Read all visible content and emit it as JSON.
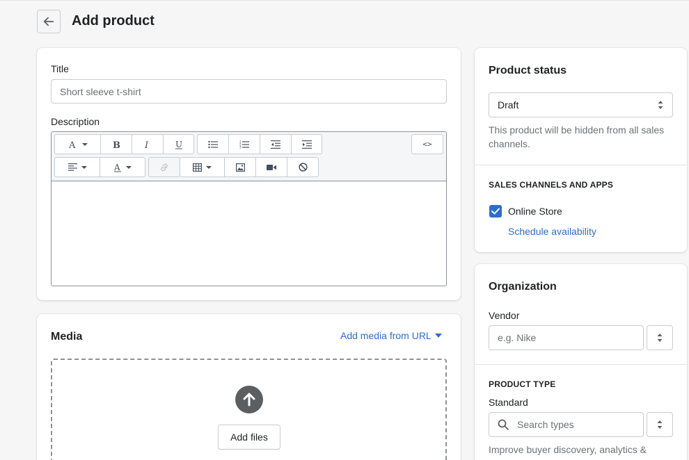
{
  "header": {
    "title": "Add product"
  },
  "product_form": {
    "title_label": "Title",
    "title_placeholder": "Short sleeve t-shirt",
    "description_label": "Description",
    "html_toggle": "<>"
  },
  "media": {
    "heading": "Media",
    "add_from_url": "Add media from URL",
    "add_files": "Add files"
  },
  "status": {
    "heading": "Product status",
    "selected": "Draft",
    "help": "This product will be hidden from all sales channels."
  },
  "sales_channels": {
    "heading": "SALES CHANNELS AND APPS",
    "channel": "Online Store",
    "channel_checked": true,
    "schedule": "Schedule availability"
  },
  "organization": {
    "heading": "Organization",
    "vendor_label": "Vendor",
    "vendor_placeholder": "e.g. Nike",
    "product_type_heading": "PRODUCT TYPE",
    "standard_label": "Standard",
    "search_placeholder": "Search types",
    "help": "Improve buyer discovery, analytics &"
  },
  "colors": {
    "accent": "#2c6ecb",
    "checkbox": "#2c6ecb"
  }
}
